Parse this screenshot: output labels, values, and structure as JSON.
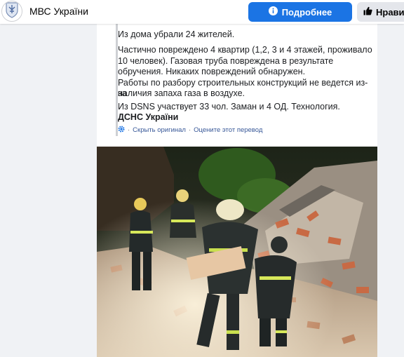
{
  "header": {
    "page_name": "МВС України",
    "more_button": "Подробнее",
    "like_button": "Нравит"
  },
  "post": {
    "lines": [
      "Из дома убрали 24 жителей.",
      "Частично повреждено 4 квартир (1,2, 3 и 4 этажей, проживало",
      "10 человек). Газовая труба повреждена в результате",
      "обручения. Никаких повреждений обнаружен.",
      "Работы по разбору строительных конструкций не ведется из-за",
      "наличия запаха газа в воздухе.",
      "Из DSNS участвует 33 чол. Заман и 4 ОД. Технология.",
      "ДСНС України"
    ],
    "translation": {
      "hide_original": "Скрыть оригинал",
      "separator": "·",
      "rate_translation": "Оцените этот перевод"
    }
  },
  "icons": {
    "avatar": "coat-of-arms-icon",
    "more": "info-icon",
    "like": "thumbs-up-icon",
    "translate": "gear-icon"
  },
  "colors": {
    "accent": "#1b74e4",
    "link": "#385898",
    "background": "#f0f2f5"
  }
}
